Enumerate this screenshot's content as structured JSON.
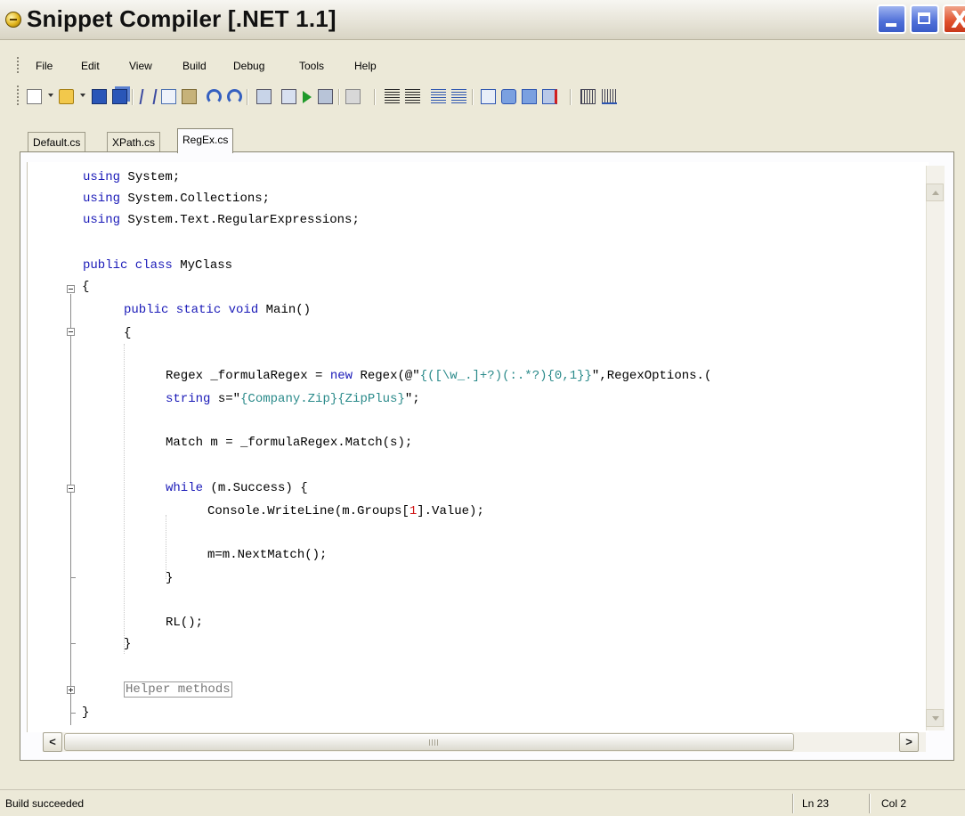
{
  "window": {
    "title": "Snippet Compiler [.NET 1.1]",
    "close_glyph": "X",
    "icon": "app-icon"
  },
  "menu": [
    "File",
    "Edit",
    "View",
    "Build",
    "Debug",
    "Tools",
    "Help"
  ],
  "tabs": [
    {
      "label": "Default.cs",
      "active": false
    },
    {
      "label": "XPath.cs",
      "active": false
    },
    {
      "label": "RegEx.cs",
      "active": true
    }
  ],
  "toolbar_icons": [
    "new-file-icon",
    "open-folder-icon",
    "save-icon",
    "save-all-icon",
    "cut-icon",
    "copy-icon",
    "paste-icon",
    "undo-icon",
    "redo-icon",
    "build-icon",
    "output-icon",
    "run-icon",
    "run-with-args-icon",
    "stop-icon",
    "outdent-icon",
    "indent-icon",
    "comment-icon",
    "uncomment-icon",
    "form-icon",
    "references-icon",
    "export-icon",
    "clear-icon",
    "calendar-icon",
    "options-icon"
  ],
  "code": {
    "l1_kw": "using",
    "l1_rest": " System;",
    "l2_kw": "using",
    "l2_rest": " System.Collections;",
    "l3_kw": "using",
    "l3_rest": " System.Text.RegularExpressions;",
    "l5_kw": "public class",
    "l5_rest": " MyClass",
    "l6": "{",
    "l7_kw": "public static void",
    "l7_rest": " Main()",
    "l8": "{",
    "l10_a": "Regex _formulaRegex = ",
    "l10_kw": "new",
    "l10_b": " Regex(@\"",
    "l10_str": "{([\\w_.]+?)(:.*?){0,1}}",
    "l10_c": "\",RegexOptions.(",
    "l11_kw": "string",
    "l11_a": " s=\"",
    "l11_str": "{Company.Zip}{ZipPlus}",
    "l11_b": "\";",
    "l13": "Match m = _formulaRegex.Match(s);",
    "l15_kw": "while",
    "l15_rest": " (m.Success) {",
    "l16_a": "Console.WriteLine(m.Groups[",
    "l16_num": "1",
    "l16_b": "].Value);",
    "l18": "m=m.NextMatch();",
    "l19": "}",
    "l21": "RL();",
    "l22": "}",
    "l24_collapsed": "Helper methods",
    "l25": "}"
  },
  "hscroll_arrows": {
    "left": "<",
    "right": ">"
  },
  "status": {
    "message": "Build succeeded",
    "line": "Ln 23",
    "col": "Col 2"
  }
}
